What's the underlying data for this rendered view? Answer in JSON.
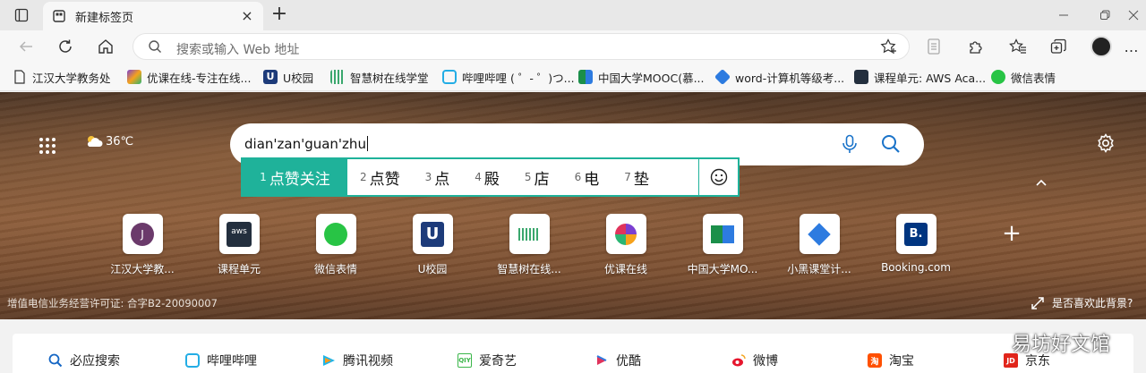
{
  "tab": {
    "title": "新建标签页"
  },
  "address": {
    "placeholder": "搜索或输入 Web 地址"
  },
  "bookmarks": [
    {
      "label": "江汉大学教务处",
      "color": "#555555"
    },
    {
      "label": "优课在线-专注在线...",
      "color": "#7b3fd1"
    },
    {
      "label": "U校园",
      "color": "#1d3b7a"
    },
    {
      "label": "智慧树在线学堂",
      "color": "#3aa76d"
    },
    {
      "label": "哔哩哔哩 ( ゜- ゜)つ...",
      "color": "#23ade5"
    },
    {
      "label": "中国大学MOOC(慕...",
      "color": "#1b8f4a"
    },
    {
      "label": "word-计算机等级考...",
      "color": "#2d7be0"
    },
    {
      "label": "课程单元: AWS Aca...",
      "color": "#232f3e"
    },
    {
      "label": "微信表情",
      "color": "#28c445"
    }
  ],
  "weather": {
    "temp": "36℃"
  },
  "search": {
    "typed": "dian'zan'guan'zhu"
  },
  "ime": {
    "candidates": [
      {
        "n": "1",
        "text": "点赞关注"
      },
      {
        "n": "2",
        "text": "点赞"
      },
      {
        "n": "3",
        "text": "点"
      },
      {
        "n": "4",
        "text": "殿"
      },
      {
        "n": "5",
        "text": "店"
      },
      {
        "n": "6",
        "text": "电"
      },
      {
        "n": "7",
        "text": "垫"
      }
    ]
  },
  "tiles": [
    {
      "label": "江汉大学教...",
      "icon": "J"
    },
    {
      "label": "课程单元",
      "icon": "aws"
    },
    {
      "label": "微信表情",
      "icon": "wechat"
    },
    {
      "label": "U校园",
      "icon": "U"
    },
    {
      "label": "智慧树在线...",
      "icon": "zhihuishu"
    },
    {
      "label": "优课在线",
      "icon": "youke"
    },
    {
      "label": "中国大学MO...",
      "icon": "mooc"
    },
    {
      "label": "小黑课堂计...",
      "icon": "xiaohei"
    },
    {
      "label": "Booking.com",
      "icon": "B."
    }
  ],
  "license": "增值电信业务经营许可证: 合字B2-20090007",
  "like_bg": "是否喜欢此背景?",
  "quick_links": [
    {
      "label": "必应搜索",
      "color": "#1466c4"
    },
    {
      "label": "哔哩哔哩",
      "color": "#23ade5"
    },
    {
      "label": "腾讯视频",
      "color": "#20b5e8"
    },
    {
      "label": "爱奇艺",
      "color": "#3bb64a"
    },
    {
      "label": "优酷",
      "color": "#e0335c"
    },
    {
      "label": "微博",
      "color": "#e6162d"
    },
    {
      "label": "淘宝",
      "color": "#ff5000"
    },
    {
      "label": "京东",
      "color": "#e1251b"
    }
  ],
  "watermark": "易坊好文馆"
}
